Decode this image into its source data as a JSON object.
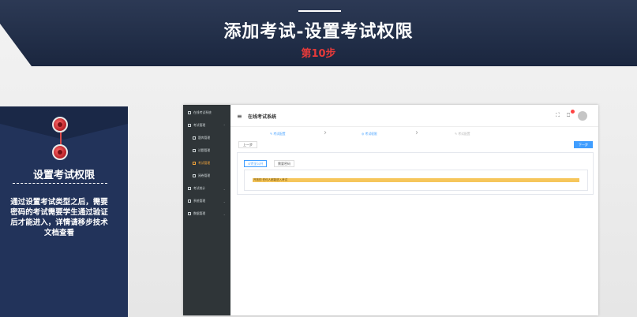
{
  "slide": {
    "title": "添加考试-设置考试权限",
    "step": "第10步"
  },
  "card": {
    "title": "设置考试权限",
    "body": "通过设置考试类型之后，需要密码的考试需要学生通过验证后才能进入，详情请移步技术文档查看"
  },
  "app": {
    "header_title": "在线考试系统",
    "sidebar": [
      {
        "label": "在线考试系统",
        "type": "top"
      },
      {
        "label": "考试管理",
        "type": "group"
      },
      {
        "label": "题库管理",
        "type": "sub"
      },
      {
        "label": "试题管理",
        "type": "sub"
      },
      {
        "label": "考试管理",
        "type": "sub",
        "active": true
      },
      {
        "label": "阅卷管理",
        "type": "sub"
      },
      {
        "label": "考试统计",
        "type": "group"
      },
      {
        "label": "系统管理",
        "type": "group"
      },
      {
        "label": "数据管理",
        "type": "group"
      }
    ],
    "steps": [
      "考试配置",
      "考试权限",
      "考试配置"
    ],
    "prev_label": "上一步",
    "next_label": "下一步",
    "tabs": [
      "完全公开",
      "需要密码"
    ],
    "notice": "开放的 任何人都能进入考试",
    "colors": {
      "accent": "#409eff",
      "warning": "#f6c65b",
      "sidebar": "#2f3538",
      "active": "#f3a53b"
    }
  }
}
